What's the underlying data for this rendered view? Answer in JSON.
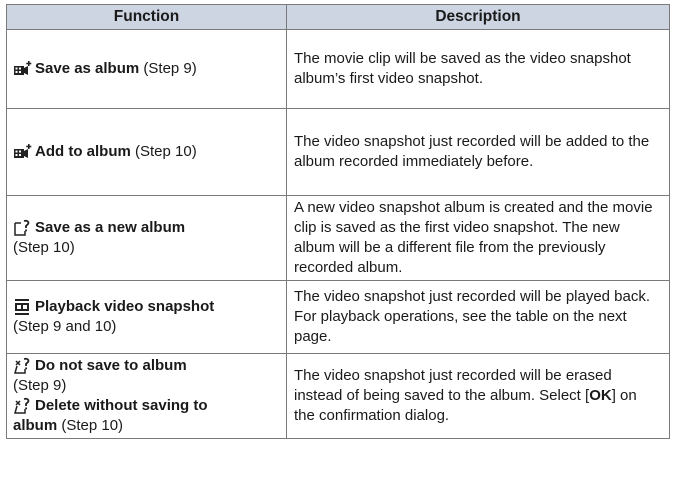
{
  "table": {
    "header": {
      "function": "Function",
      "description": "Description"
    },
    "rows": [
      {
        "icon": "video-snapshot-album-icon",
        "name": "Save as album",
        "step": " (Step 9)",
        "description": "The movie clip will be saved as the video snapshot album’s first video snapshot."
      },
      {
        "icon": "video-snapshot-album-icon",
        "name": "Add to album",
        "step": " (Step 10)",
        "description": "The video snapshot just recorded will be added to the album recorded immediately before."
      },
      {
        "icon": "new-album-icon",
        "name": "Save as a new album",
        "step": "(Step 10)",
        "description": "A new video snapshot album is created and the movie clip is saved as the first video snapshot. The new album will be a different file from the previously recorded album."
      },
      {
        "icon": "playback-icon",
        "name": "Playback video snapshot",
        "step": "(Step 9 and 10)",
        "description": "The video snapshot just recorded will be played back. For playback operations, see the table on the next page."
      },
      {
        "icon": "delete-icon",
        "name": "Do not save to album",
        "step": "(Step 9)",
        "name2": "Delete without saving to",
        "name2_cont": "album",
        "step2": " (Step 10)",
        "description_pre": "The video snapshot just recorded will be erased instead of being saved to the album. Select [",
        "description_bold": "OK",
        "description_post": "] on the confirmation dialog."
      }
    ]
  }
}
